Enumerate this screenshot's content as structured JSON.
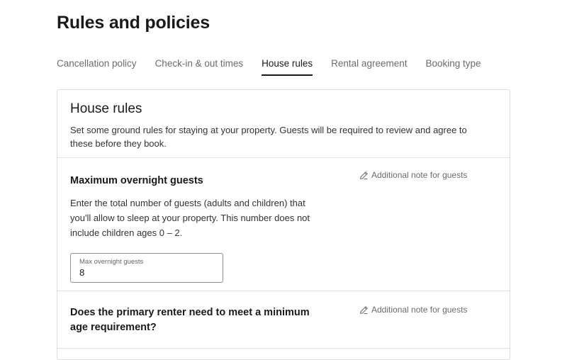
{
  "page": {
    "title": "Rules and policies"
  },
  "tabs": [
    {
      "label": "Cancellation policy"
    },
    {
      "label": "Check-in & out times"
    },
    {
      "label": "House rules"
    },
    {
      "label": "Rental agreement"
    },
    {
      "label": "Booking type"
    }
  ],
  "active_tab": "House rules",
  "card": {
    "title": "House rules",
    "description": "Set some ground rules for staying at your property. Guests will be required to review and agree to these before they book."
  },
  "sections": [
    {
      "title": "Maximum overnight guests",
      "description": "Enter the total number of guests (adults and children) that you'll allow to sleep at your property. This number does not include children ages 0 – 2.",
      "note_link": "Additional note for guests",
      "field": {
        "label": "Max overnight guests",
        "value": "8"
      }
    },
    {
      "title": "Does the primary renter need to meet a minimum age requirement?",
      "note_link": "Additional note for guests"
    }
  ],
  "icons": {
    "note": "pencil-icon"
  }
}
